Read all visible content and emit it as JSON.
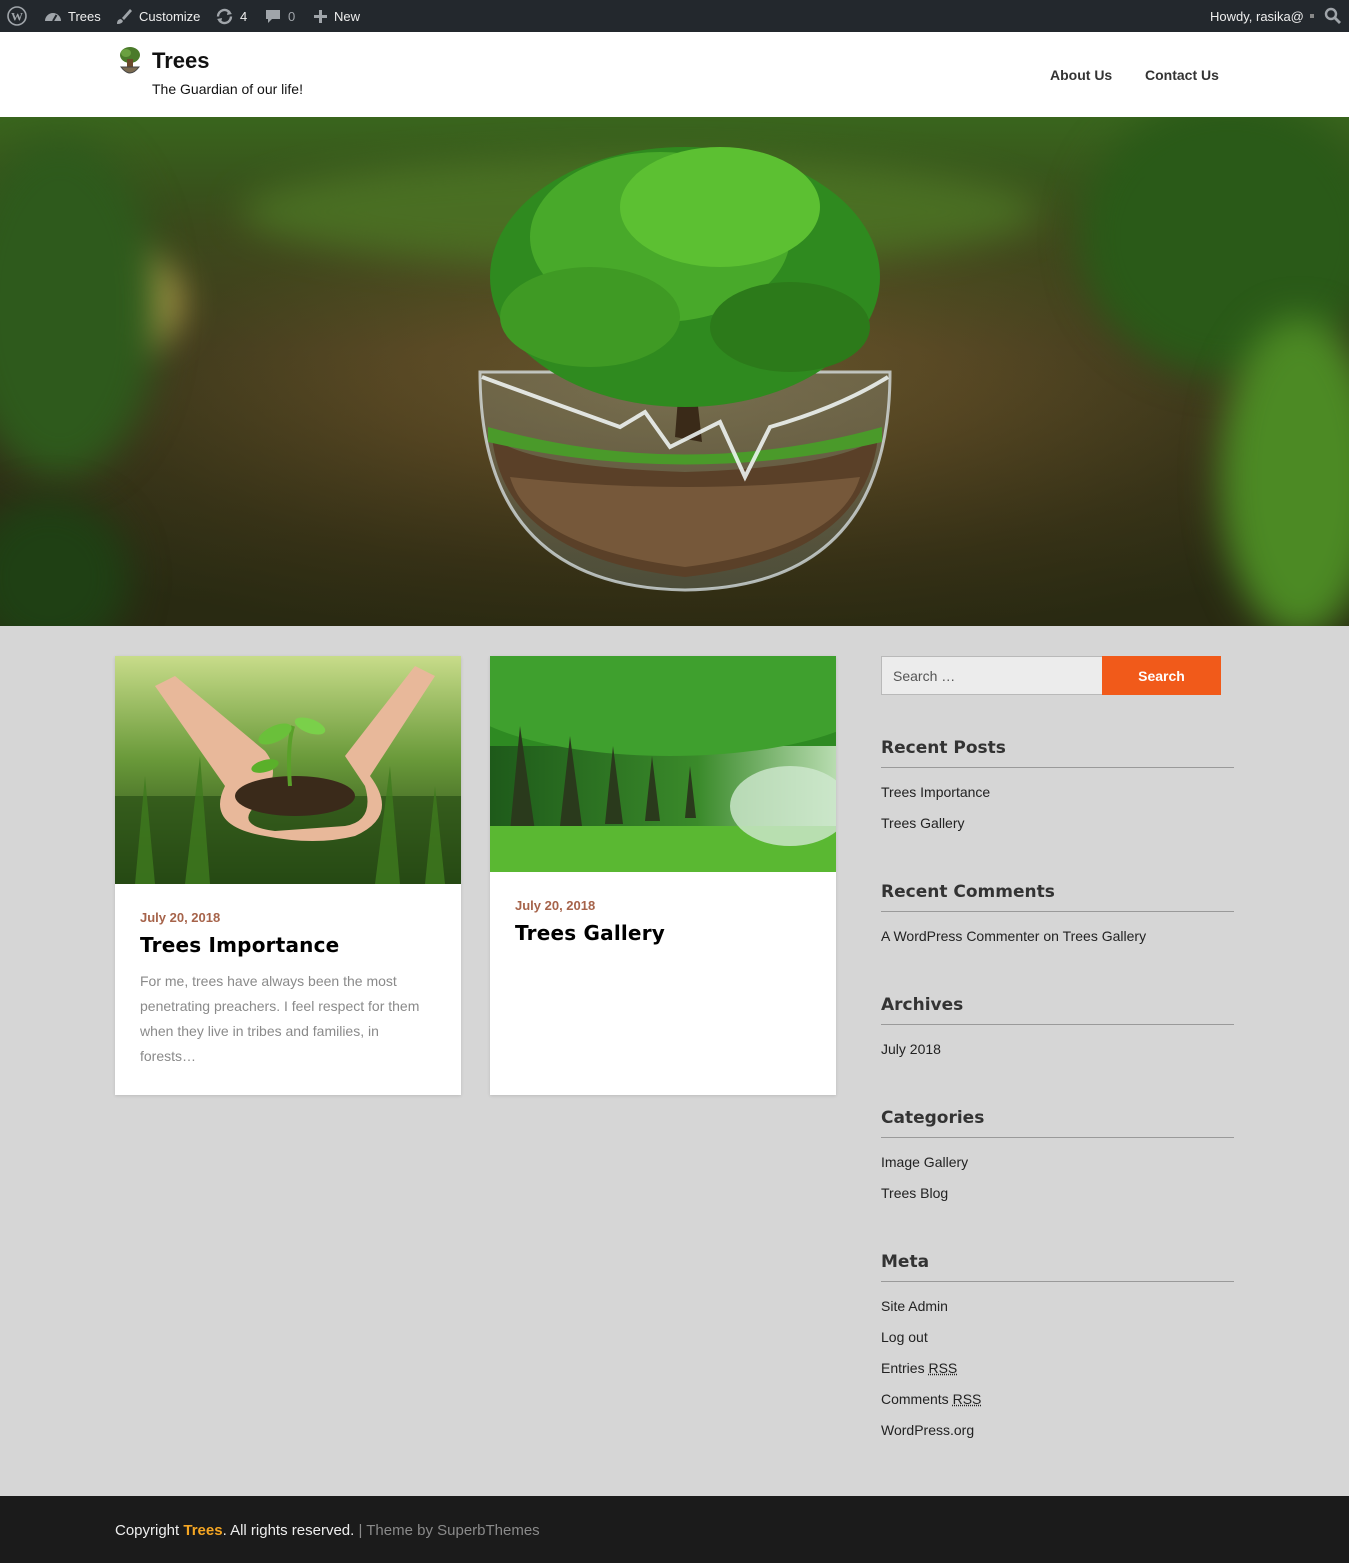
{
  "admin_bar": {
    "site_name": "Trees",
    "customize": "Customize",
    "updates_count": "4",
    "comments_count": "0",
    "new": "New",
    "howdy": "Howdy, rasika@"
  },
  "header": {
    "title": "Trees",
    "tagline": "The Guardian of our life!",
    "nav": [
      "About Us",
      "Contact Us"
    ]
  },
  "posts": [
    {
      "date": "July 20, 2018",
      "title": "Trees Importance",
      "excerpt": "For me, trees have always been the most penetrating preachers. I feel respect for them when they live in tribes and families, in forests…"
    },
    {
      "date": "July 20, 2018",
      "title": "Trees Gallery",
      "excerpt": ""
    }
  ],
  "sidebar": {
    "search_placeholder": "Search …",
    "search_button": "Search",
    "recent_posts": {
      "title": "Recent Posts",
      "items": [
        "Trees Importance",
        "Trees Gallery"
      ]
    },
    "recent_comments": {
      "title": "Recent Comments",
      "author": "A WordPress Commenter",
      "on": "on",
      "post": "Trees Gallery"
    },
    "archives": {
      "title": "Archives",
      "items": [
        "July 2018"
      ]
    },
    "categories": {
      "title": "Categories",
      "items": [
        "Image Gallery",
        "Trees Blog"
      ]
    },
    "meta": {
      "title": "Meta",
      "site_admin": "Site Admin",
      "log_out": "Log out",
      "entries": "Entries",
      "comments": "Comments",
      "rss": "RSS",
      "wordpress_org": "WordPress.org"
    }
  },
  "footer": {
    "copyright": "Copyright",
    "brand": "Trees",
    "rights": ". All rights reserved.",
    "separator": " | ",
    "theme_by": "Theme by SuperbThemes"
  },
  "colors": {
    "admin_bar": "#23282d",
    "accent_orange": "#f15a1a",
    "date_color": "#a6634a",
    "footer_brand": "#f5a623",
    "page_bg": "#d6d6d6"
  }
}
